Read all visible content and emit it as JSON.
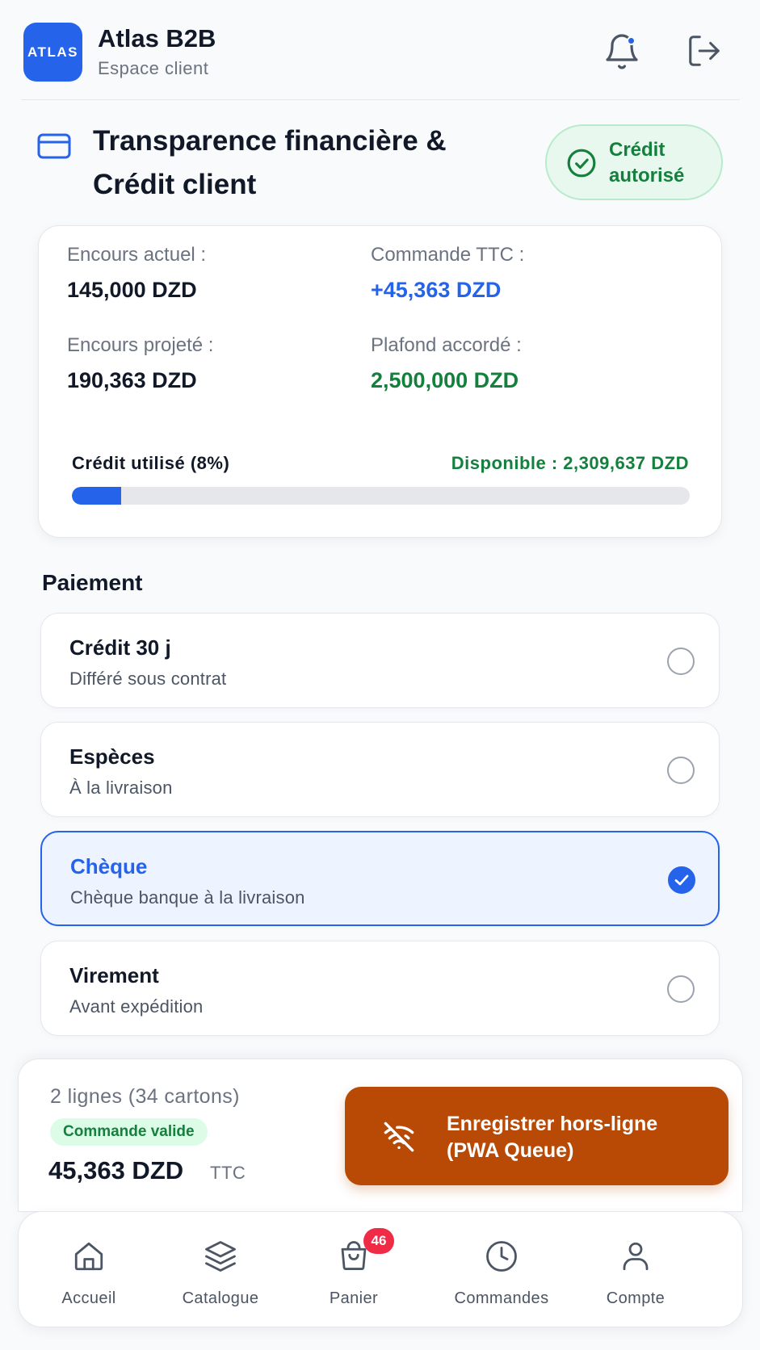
{
  "header": {
    "logo_text": "ATLAS",
    "title": "Atlas B2B",
    "subtitle": "Espace client",
    "icons": [
      "bell-icon",
      "logout-icon"
    ],
    "notification_dot_color": "#2563eb"
  },
  "section": {
    "icon": "credit-card-icon",
    "title_line1": "Transparence financière &",
    "title_line2": "Crédit client",
    "badge": {
      "icon": "check-circle-icon",
      "line1": "Crédit",
      "line2": "autorisé",
      "color": "#15803d"
    }
  },
  "finance": {
    "current_label": "Encours actuel :",
    "current_value": "145,000 DZD",
    "order_label": "Commande TTC :",
    "order_value": "+45,363 DZD",
    "projected_label": "Encours projeté :",
    "projected_value": "190,363 DZD",
    "ceiling_label": "Plafond accordé :",
    "ceiling_value": "2,500,000 DZD",
    "used_label": "Crédit utilisé (8%)",
    "available_label": "Disponible : 2,309,637 DZD",
    "used_fraction": 0.08
  },
  "payment": {
    "title": "Paiement",
    "options": [
      {
        "name": "Crédit 30 j",
        "desc": "Différé sous contrat",
        "selected": false
      },
      {
        "name": "Espèces",
        "desc": "À la livraison",
        "selected": false
      },
      {
        "name": "Chèque",
        "desc": "Chèque banque à la livraison",
        "selected": true
      },
      {
        "name": "Virement",
        "desc": "Avant expédition",
        "selected": false
      }
    ]
  },
  "summary": {
    "lines": "2 lignes (34 cartons)",
    "status_badge": "Commande valide",
    "total": "45,363 DZD",
    "total_suffix": "TTC",
    "action_line1": "Enregistrer hors-ligne",
    "action_line2": "(PWA Queue)",
    "action_icon": "wifi-off-icon",
    "action_color": "#b84a05"
  },
  "nav": {
    "items": [
      {
        "label": "Accueil",
        "icon": "home-icon"
      },
      {
        "label": "Catalogue",
        "icon": "layers-icon"
      },
      {
        "label": "Panier",
        "icon": "shopping-bag-icon",
        "badge": "46"
      },
      {
        "label": "Commandes",
        "icon": "clock-icon"
      },
      {
        "label": "Compte",
        "icon": "user-icon"
      }
    ]
  }
}
